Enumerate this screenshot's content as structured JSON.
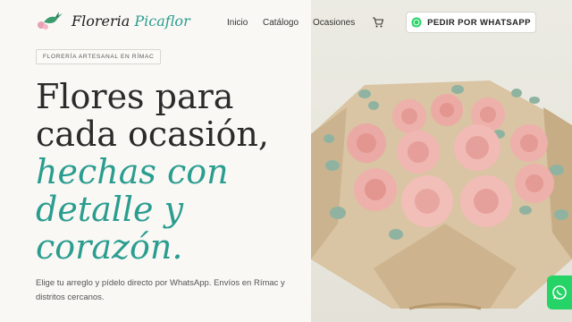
{
  "header": {
    "logo_text": "Floreria",
    "logo_accent": "Picaflor",
    "nav": [
      {
        "label": "Inicio"
      },
      {
        "label": "Catálogo"
      },
      {
        "label": "Ocasiones"
      }
    ],
    "cta_label": "PEDIR POR WHATSAPP"
  },
  "hero": {
    "badge": "FLORERÍA ARTESANAL EN RÍMAC",
    "title_lines": [
      "Flores para",
      "cada ocasión,"
    ],
    "title_italic_lines": [
      "hechas con",
      "detalle y",
      "corazón."
    ],
    "description": "Elige tu arreglo y pídelo directo por WhatsApp. Envíos en Rímac y distritos cercanos."
  },
  "icons": {
    "logo": "hummingbird-flower-icon",
    "cart": "cart-icon",
    "cta": "whatsapp-icon",
    "floating": "whatsapp-icon"
  },
  "colors": {
    "accent": "#2a9d8f",
    "whatsapp": "#25d366",
    "background": "#faf8f5"
  }
}
